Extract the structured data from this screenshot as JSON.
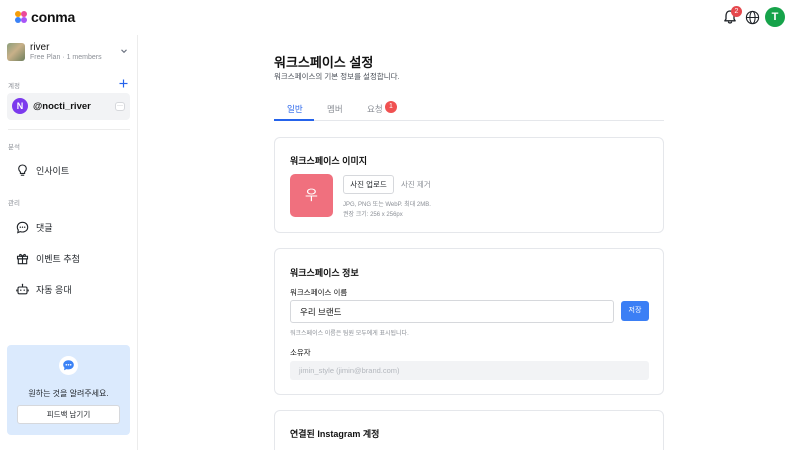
{
  "app": {
    "logo_text": "conma",
    "notification_count": "2",
    "user_initial": "T"
  },
  "sidebar": {
    "workspace": {
      "name": "river",
      "plan": "Free Plan · 1 members"
    },
    "accounts_label": "계정",
    "account": {
      "initial": "N",
      "handle": "@nocti_river",
      "more": "···"
    },
    "analysis_label": "분석",
    "insight": "인사이트",
    "manage_label": "관리",
    "comments": "댓글",
    "event_draw": "이벤트 추첨",
    "auto_reply": "자동 응대",
    "feedback": {
      "text": "원하는 것을 알려주세요.",
      "button": "피드백 남기기"
    }
  },
  "main": {
    "title": "워크스페이스 설정",
    "subtitle": "워크스페이스의 기본 정보를 설정합니다.",
    "tabs": [
      {
        "label": "일반"
      },
      {
        "label": "멤버"
      },
      {
        "label": "요청",
        "badge": "1"
      }
    ],
    "image_card": {
      "title": "워크스페이스 이미지",
      "preview_char": "우",
      "upload": "사진 업로드",
      "remove": "사진 제거",
      "hint1": "JPG, PNG 또는 WebP. 최대 2MB.",
      "hint2": "권장 크기: 256 x 256px"
    },
    "info_card": {
      "title": "워크스페이스 정보",
      "name_label": "워크스페이스 이름",
      "name_value": "우리 브랜드",
      "save": "저장",
      "name_hint": "워크스페이스 이름은 팀원 모두에게 표시됩니다.",
      "owner_label": "소유자",
      "owner_value": "jimin_style (jimin@brand.com)"
    },
    "instagram_card": {
      "title": "연결된 Instagram 계정"
    }
  },
  "colors": {
    "accent": "#2563eb",
    "save_button": "#3b7ff5",
    "badge": "#f05151",
    "preview": "#f0707e",
    "feedback_bg": "#dbeafd"
  }
}
